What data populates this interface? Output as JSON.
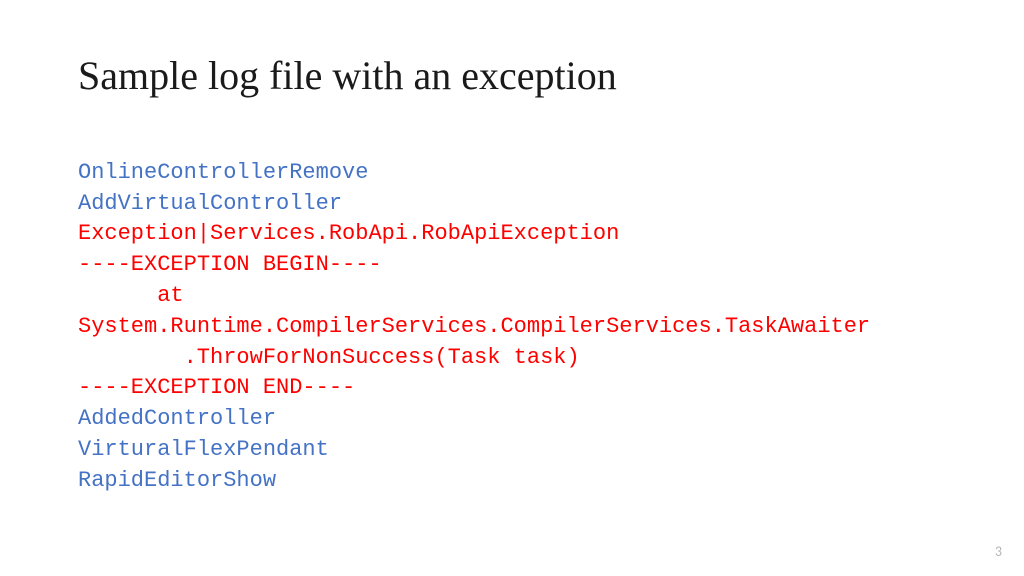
{
  "title": "Sample log file with an exception",
  "lines": {
    "l1": "OnlineControllerRemove",
    "l2": "AddVirtualController",
    "l3": "Exception|Services.RobApi.RobApiException",
    "l4": "----EXCEPTION BEGIN----",
    "l5_indent": "   at",
    "l6": "System.Runtime.CompilerServices.CompilerServices.TaskAwaiter",
    "l7_indent": "    .ThrowForNonSuccess(Task task)",
    "l8": "----EXCEPTION END----",
    "l9": "AddedController",
    "l10": "VirturalFlexPendant",
    "l11": "RapidEditorShow"
  },
  "pageNumber": "3",
  "colors": {
    "blue": "#4472C4",
    "red": "#FF0000"
  }
}
